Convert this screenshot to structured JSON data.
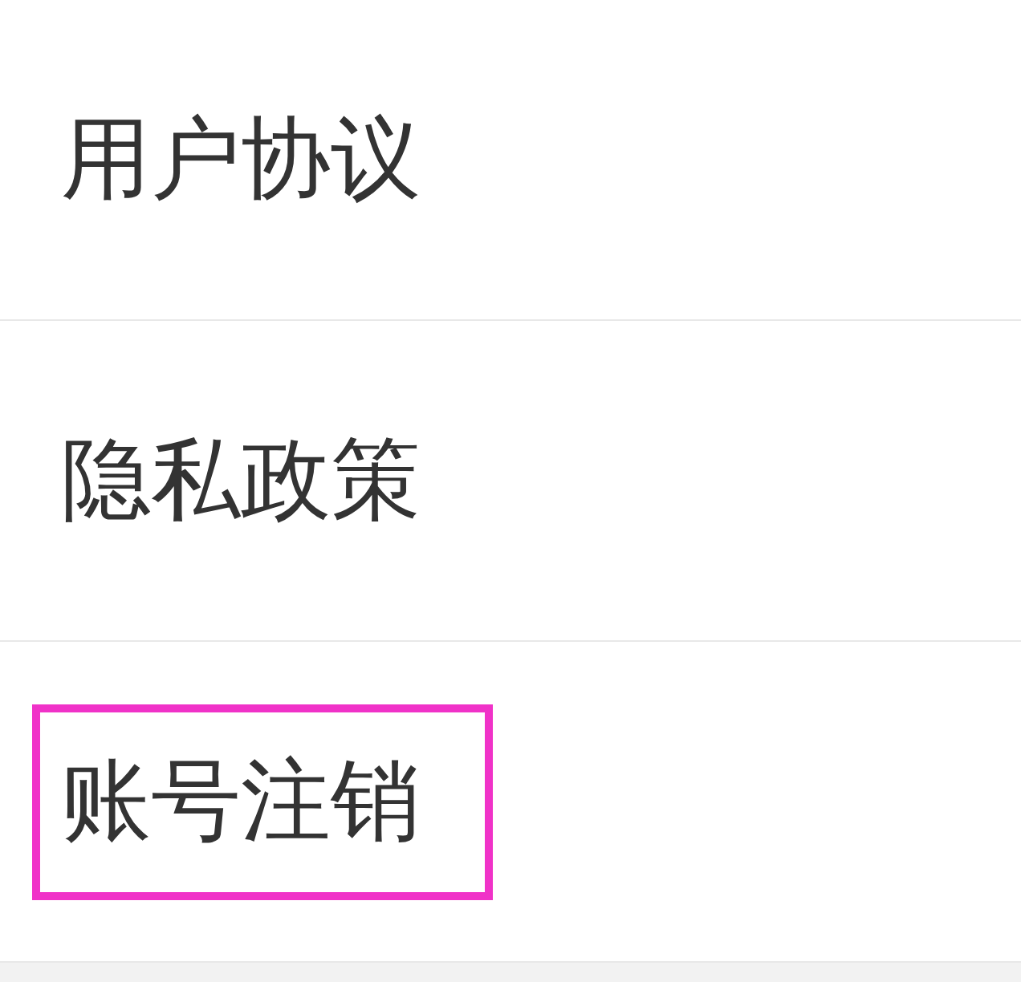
{
  "items": [
    {
      "label": "用户协议",
      "highlighted": false
    },
    {
      "label": "隐私政策",
      "highlighted": false
    },
    {
      "label": "账号注销",
      "highlighted": true
    }
  ]
}
